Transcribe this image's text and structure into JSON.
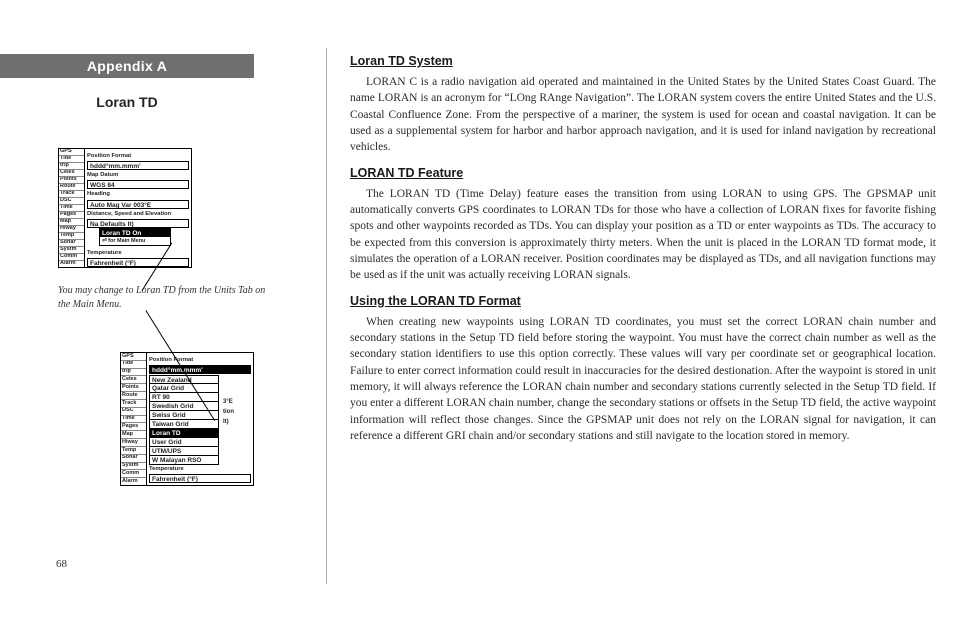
{
  "appendix_label": "Appendix A",
  "section_title": "Loran TD",
  "page_number": "68",
  "caption": "You may change to Loran TD from the Units Tab on the Main Menu.",
  "fig_tabs": [
    "GPS",
    "Tide",
    "trip",
    "Celes",
    "Points",
    "Route",
    "Track",
    "DSC",
    "Time",
    "Pages",
    "Map",
    "Hiway",
    "Temp",
    "Sonar",
    "Systm",
    "Comm",
    "Alarm"
  ],
  "fig1": {
    "posfmt_label": "Position Format",
    "posfmt_value": "hddd°mm.mmm'",
    "mapdatum_label": "Map Datum",
    "mapdatum_value": "WGS 84",
    "heading_label": "Heading",
    "heading_value": "Auto Mag Var  003°E",
    "dist_label": "Distance, Speed and Elevation",
    "dist_value": "Na Defaults        lt)",
    "popup1": "Loran TD On",
    "popup2": "⏎ for Main Menu",
    "temp_label": "Temperature",
    "temp_value": "Fahrenheit (°F)"
  },
  "fig2": {
    "posfmt_label": "Position Format",
    "posfmt_value": "hddd°mm.mmm'",
    "options": [
      "New Zealand",
      "Qatar Grid",
      "RT 90",
      "Swedish Grid",
      "Swiss Grid",
      "Taiwan Grid",
      "Loran TD",
      "User Grid",
      "UTM/UPS",
      "W Malayan RSO"
    ],
    "side_frag1": "3°E",
    "side_frag2": "tion",
    "side_frag3": "lt)",
    "temp_label": "Temperature",
    "temp_value": "Fahrenheit (°F)"
  },
  "body": {
    "h1": "Loran TD System",
    "p1": "LORAN C is a radio navigation aid operated and maintained in the United States by the United States Coast Guard. The name LORAN is an acronym for “LOng RAnge Navigation”. The LORAN system covers the entire United States and the U.S. Coastal Confluence Zone. From the perspective of a mariner, the system is used for ocean and coastal navigation. It can be used as a supplemental system for harbor and harbor approach navigation, and it is used for inland navigation by recreational vehicles.",
    "h2": "LORAN TD Feature",
    "p2": "The LORAN TD (Time Delay) feature eases the transition from using LORAN to using GPS. The GPSMAP unit automatically converts GPS coordinates to LORAN TDs for those who have a collection of LORAN fixes for favorite fishing spots and other waypoints recorded as TDs. You can display your position as a TD or enter waypoints as TDs. The accuracy to be expected from this conversion is approximately thirty meters. When the unit is placed in the LORAN TD format mode, it simulates the operation of a LORAN receiver. Position coordinates may be displayed as TDs, and all navigation functions may be used as if the unit was actually receiving LORAN signals.",
    "h3": "Using the LORAN TD Format",
    "p3": "When creating new waypoints using LORAN TD coordinates, you must set the correct LORAN chain number and secondary stations in the Setup TD field before storing the waypoint. You must have the correct chain number as well as the secondary station identifiers to use this option correctly. These values will vary per coordinate set or geographical location. Failure to enter correct information could result in inaccuracies for the desired destionation. After the waypoint is stored in unit memory, it will always reference the LORAN chain number and secondary stations currently selected in the Setup TD field. If you enter a different LORAN chain number, change the secondary stations or offsets in the Setup TD field, the active waypoint information will reflect those changes. Since the GPSMAP unit does not rely on the LORAN signal for navigation, it can reference a different GRI chain and/or secondary stations and still navigate to the location stored in memory."
  }
}
